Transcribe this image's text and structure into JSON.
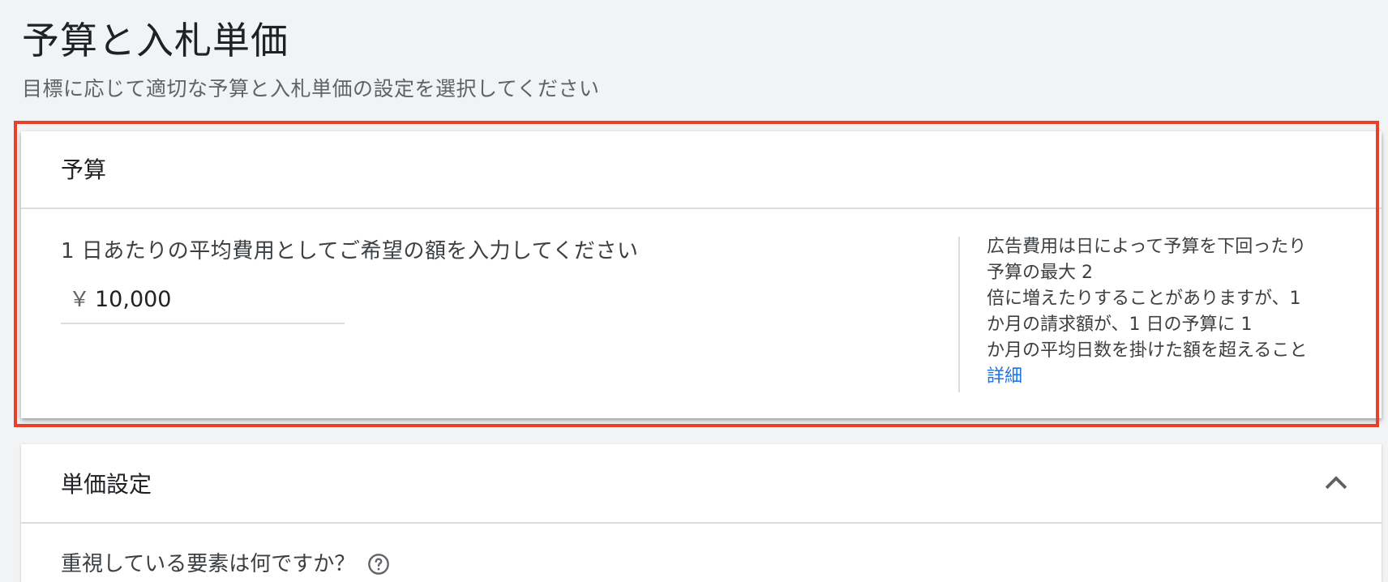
{
  "page": {
    "title": "予算と入札単価",
    "subtitle": "目標に応じて適切な予算と入札単価の設定を選択してください"
  },
  "budget_section": {
    "title": "予算",
    "prompt": "1 日あたりの平均費用としてご希望の額を入力してください",
    "currency_symbol": "￥",
    "amount": "10,000",
    "help_lines": [
      "広告費用は日によって予算を下回ったり",
      "予算の最大 2",
      "倍に増えたりすることがありますが、1",
      "か月の請求額が、1 日の予算に 1",
      "か月の平均日数を掛けた額を超えること"
    ],
    "learn_more_label": "詳細",
    "highlight_color": "#e8402a"
  },
  "bid_section": {
    "title": "単価設定",
    "question": "重視している要素は何ですか？",
    "collapse_icon": "chevron-up-icon",
    "help_icon": "help-circle-icon"
  },
  "colors": {
    "background": "#f1f3f4",
    "card": "#ffffff",
    "link": "#1a73e8",
    "divider": "#dadce0"
  }
}
